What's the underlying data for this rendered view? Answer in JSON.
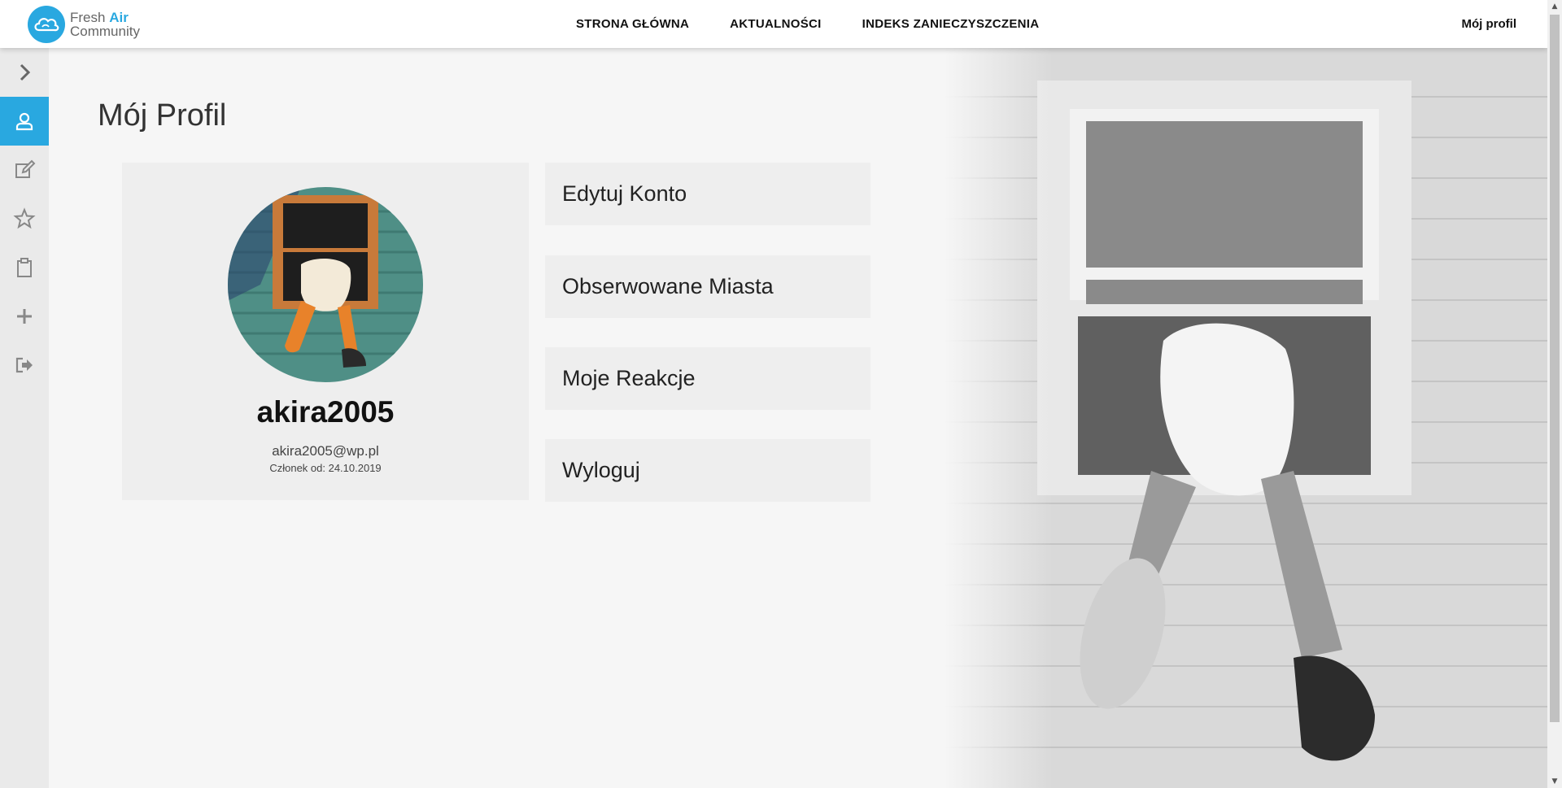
{
  "brand": {
    "line1": "Fresh",
    "line1_accent": "Air",
    "line2": "Community"
  },
  "nav": {
    "links": [
      "STRONA GŁÓWNA",
      "AKTUALNOŚCI",
      "INDEKS ZANIECZYSZCZENIA"
    ],
    "right": "Mój profil"
  },
  "sidebar": {
    "items": [
      {
        "icon": "chevron-right-icon",
        "active": false
      },
      {
        "icon": "user-icon",
        "active": true
      },
      {
        "icon": "edit-icon",
        "active": false
      },
      {
        "icon": "star-icon",
        "active": false
      },
      {
        "icon": "clipboard-icon",
        "active": false
      },
      {
        "icon": "plus-icon",
        "active": false
      },
      {
        "icon": "logout-icon",
        "active": false
      }
    ]
  },
  "page": {
    "title": "Mój Profil"
  },
  "profile": {
    "username": "akira2005",
    "email": "akira2005@wp.pl",
    "member_since": "Członek od: 24.10.2019"
  },
  "menu": {
    "items": [
      "Edytuj Konto",
      "Obserwowane Miasta",
      "Moje Reakcje",
      "Wyloguj"
    ]
  },
  "colors": {
    "accent": "#29a8e0",
    "background": "#f6f6f6",
    "card": "#eeeeee"
  }
}
